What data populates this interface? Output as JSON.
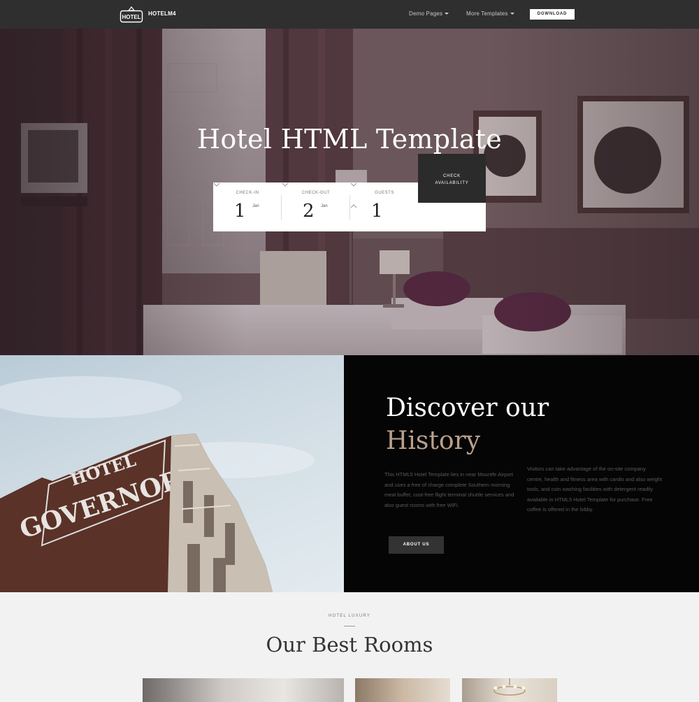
{
  "nav": {
    "logo_badge_text": "HOTEL",
    "brand": "HOTELM4",
    "demo_pages": "Demo Pages",
    "more_templates": "More Templates",
    "download": "DOWNLOAD"
  },
  "hero": {
    "title": "Hotel HTML Template",
    "booking": {
      "checkin": {
        "label": "CHECK-IN",
        "value": "1",
        "month": "Jan"
      },
      "checkout": {
        "label": "CHECK-OUT",
        "value": "2",
        "month": "Jan"
      },
      "guests": {
        "label": "GUESTS",
        "value": "1"
      },
      "button": "CHECK AVAILABILITY"
    }
  },
  "history": {
    "title_line1": "Discover our",
    "title_line2": "History",
    "sign_line1": "HOTEL",
    "sign_line2": "GOVERNOR",
    "col1": "This HTML5 Hotel Template lies in near Mountfe Airport and uses a free of charge complete Southern morning meal buffet, cost-free flight terminal shuttle services and also guest rooms with free WiFi.",
    "col2": "Visitors can take advantage of the on-site company centre, health and fitness area with cardio and also weight tools, and coin washing facilities with detergent readily available in HTML5 Hotel Template for purchase. Free coffee is offered in the lobby.",
    "button": "ABOUT US"
  },
  "rooms": {
    "kicker": "HOTEL LUXURY",
    "title": "Our Best Rooms"
  },
  "colors": {
    "nav_bg": "#2f2f2f",
    "accent": "#b9a08d",
    "dark_panel": "#050505",
    "button_dark": "#2b2b2b"
  },
  "icons": [
    "hotel-logo-icon",
    "caret-down-icon",
    "chevron-down-icon",
    "chevron-up-icon"
  ]
}
